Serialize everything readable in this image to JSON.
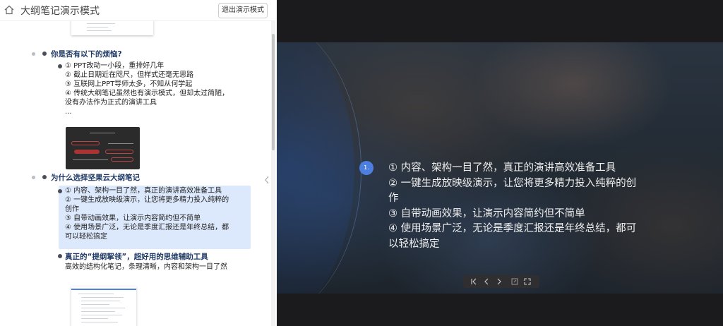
{
  "header": {
    "title": "大纲笔记演示模式",
    "exit_label": "退出演示模式"
  },
  "outline": {
    "section1": {
      "heading": "你是否有以下的烦恼?",
      "items": [
        "① PPT改动一小段，重排好几年",
        "② 截止日期近在咫尺，但样式还毫无思路",
        "③ 互联网上PPT导师太多，不知从何学起",
        "④ 传统大纲笔记虽然也有演示模式，但却太过简陋，没有办法作为正式的演讲工具"
      ],
      "ellipsis": "..."
    },
    "section2": {
      "heading": "为什么选择坚果云大纲笔记",
      "items": [
        "① 内容、架构一目了然，真正的演讲高效准备工具",
        "② 一键生成放映级演示，让您将更多精力投入纯粹的创作",
        "③ 自带动画效果，让演示内容简约但不简单",
        "④ 使用场景广泛，无论是季度汇报还是年终总结，都可以轻松搞定"
      ],
      "sub_heading": "真正的“提纲挈领”，超好用的思维辅助工具",
      "sub_text": "高效的结构化笔记，条理清晰，内容和架构一目了然"
    }
  },
  "slide": {
    "number": "1.",
    "lines": [
      "① 内容、架构一目了然，真正的演讲高效准备工具",
      "② 一键生成放映级演示，让您将更多精力投入纯粹的创作",
      "③ 自带动画效果，让演示内容简约但不简单",
      "④ 使用场景广泛，无论是季度汇报还是年终总结，都可以轻松搞定"
    ]
  },
  "controls": {
    "first": "first-slide-icon",
    "prev": "prev-slide-icon",
    "next": "next-slide-icon",
    "edit": "edit-icon",
    "fullscreen": "fullscreen-icon"
  },
  "colors": {
    "accent": "#4d7fe0",
    "heading": "#1f3a66",
    "highlight": "#dce8fb"
  }
}
